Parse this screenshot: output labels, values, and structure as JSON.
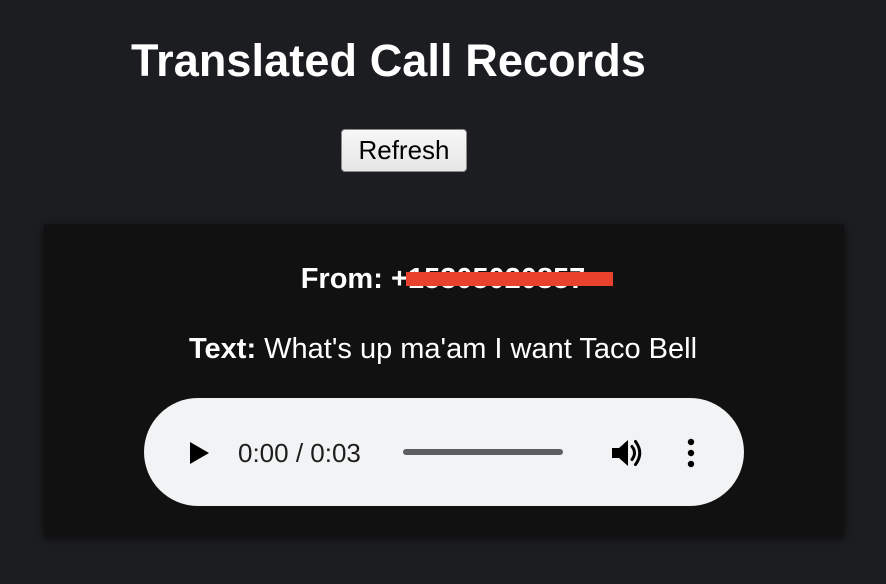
{
  "page": {
    "title": "Translated Call Records",
    "refresh_label": "Refresh"
  },
  "record": {
    "from_label": "From:",
    "from_prefix": "+",
    "from_number_redacted": "15305020857",
    "text_label": "Text:",
    "text_value": "What's up ma'am I want Taco Bell"
  },
  "audio": {
    "current_time": "0:00",
    "separator": " / ",
    "duration": "0:03",
    "progress": 0,
    "icons": {
      "play": "play-icon",
      "volume": "volume-icon",
      "more": "more-vertical-icon"
    }
  },
  "colors": {
    "background": "#1c1d20",
    "card": "#111111",
    "redaction": "#e8412c",
    "player": "#f1f3f4"
  }
}
